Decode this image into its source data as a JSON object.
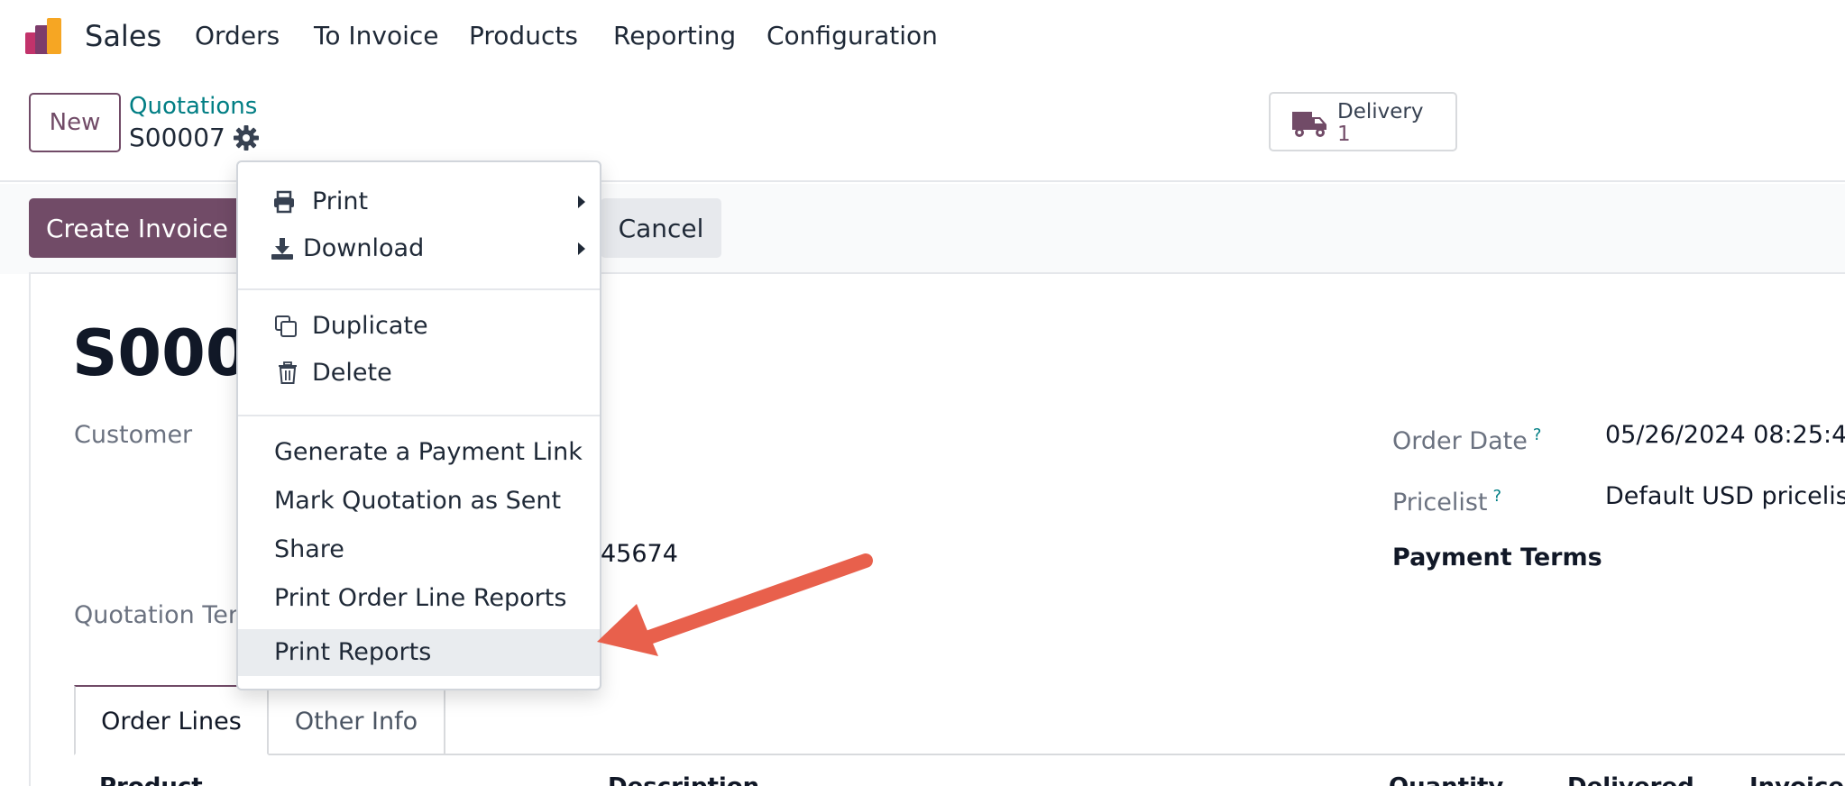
{
  "navbar": {
    "app_name": "Sales",
    "menu": [
      "Orders",
      "To Invoice",
      "Products",
      "Reporting",
      "Configuration"
    ]
  },
  "control_panel": {
    "new_label": "New",
    "breadcrumb_parent": "Quotations",
    "breadcrumb_current": "S00007",
    "delivery_label": "Delivery",
    "delivery_count": "1"
  },
  "actions": {
    "create_invoice_label": "Create Invoice",
    "cancel_label": "Cancel"
  },
  "form": {
    "order_name_partial": "S0000",
    "customer_label": "Customer",
    "partial_value": "45674",
    "quotation_template_label_partial": "Quotation Ter",
    "order_date_label": "Order Date",
    "order_date_help": "?",
    "order_date_value": "05/26/2024 08:25:4",
    "pricelist_label": "Pricelist",
    "pricelist_help": "?",
    "pricelist_value": "Default USD pricelist",
    "payment_terms_label": "Payment Terms"
  },
  "tabs": [
    "Order Lines",
    "Other Info"
  ],
  "table_headers": [
    "Product",
    "Description",
    "Quantity",
    "Delivered",
    "Invoiced"
  ],
  "dropdown": {
    "print_label": "Print",
    "download_label": "Download",
    "duplicate_label": "Duplicate",
    "delete_label": "Delete",
    "generate_link_label": "Generate a Payment Link",
    "mark_sent_label": "Mark Quotation as Sent",
    "share_label": "Share",
    "print_order_line_label": "Print Order Line Reports",
    "print_reports_label": "Print Reports"
  },
  "colors": {
    "brand": "#714b67",
    "link": "#017e84",
    "annotation_arrow": "#e8604c"
  }
}
